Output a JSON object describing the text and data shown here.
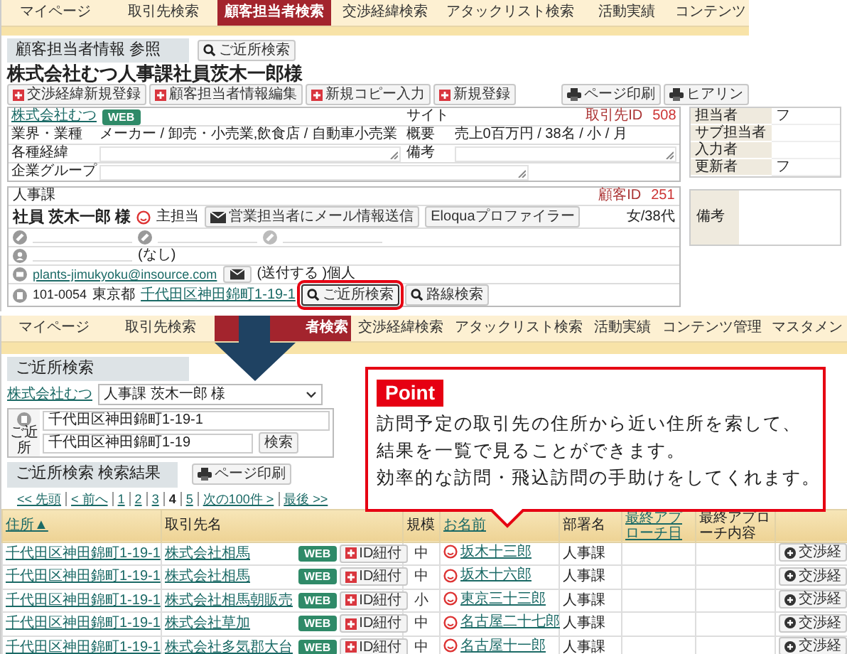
{
  "top_screen": {
    "nav_tabs": [
      {
        "label": "マイページ",
        "selected": false
      },
      {
        "label": "取引先検索",
        "selected": false
      },
      {
        "label": "顧客担当者検索",
        "selected": true
      },
      {
        "label": "交渉経緯検索",
        "selected": false
      },
      {
        "label": "アタックリスト検索",
        "selected": false
      },
      {
        "label": "活動実績",
        "selected": false
      },
      {
        "label": "コンテンツ",
        "selected": false
      }
    ],
    "section_title": "顧客担当者情報 参照",
    "nearby_button": "ご近所検索",
    "page_title": "株式会社むつ人事課社員茨木一郎様",
    "action_buttons": [
      "交渉経緯新規登録",
      "顧客担当者情報編集",
      "新規コピー入力",
      "新規登録"
    ],
    "print_buttons": [
      "ページ印刷",
      "ヒアリン"
    ],
    "company": {
      "name": "株式会社むつ",
      "web_badge": "WEB",
      "site_label": "サイト",
      "id_label": "取引先ID",
      "id": "508",
      "fields": [
        {
          "label": "業界・業種",
          "value": "メーカー / 卸売・小売業,飲食店 / 自動車小売業",
          "label2": "概要",
          "value2": "売上0百万円 / 38名 / 小 / 月"
        },
        {
          "label": "各種経緯",
          "label2": "備考"
        },
        {
          "label": "企業グループ"
        }
      ]
    },
    "contact": {
      "department": "人事課",
      "id_label": "顧客ID",
      "id": "251",
      "gender_age": "女/38代",
      "name": "社員 茨木一郎 様",
      "role": "主担当",
      "mail_button": "営業担当者にメール情報送信",
      "profiler_button": "Eloquaプロファイラー",
      "no_value": "(なし)",
      "email": "plants-jimukyoku@insource.com",
      "send_status": "(送付する )個人",
      "postal_code": "101-0054",
      "prefecture": "東京都",
      "address": "千代田区神田錦町1-19-1",
      "nearby_button": {
        "label": "ご近所検索",
        "highlighted": true
      },
      "route_button": "路線検索"
    },
    "staff_table": [
      {
        "label": "担当者",
        "value": "フ"
      },
      {
        "label": "サブ担当者"
      },
      {
        "label": "入力者"
      },
      {
        "label": "更新者",
        "value": "フ"
      }
    ],
    "notes_label": "備考"
  },
  "bottom_screen": {
    "nav_tabs": [
      {
        "label": "マイページ",
        "selected": false
      },
      {
        "label": "取引先検索",
        "selected": false
      },
      {
        "label": "者検索",
        "selected": true
      },
      {
        "label": "交渉経緯検索",
        "selected": false
      },
      {
        "label": "アタックリスト検索",
        "selected": false
      },
      {
        "label": "活動実績",
        "selected": false
      },
      {
        "label": "コンテンツ管理",
        "selected": false
      },
      {
        "label": "マスタメン",
        "selected": false
      }
    ],
    "section_title": "ご近所検索",
    "company_link": "株式会社むつ",
    "contact_select": "人事課 茨木一郎 様",
    "base_address": "千代田区神田錦町1-19-1",
    "nearby_label": "ご近所",
    "search_input": "千代田区神田錦町1-19",
    "search_button": "検索",
    "results_title": "ご近所検索 検索結果",
    "print_button": "ページ印刷",
    "pager": [
      {
        "label": "<< 先頭",
        "selected": false
      },
      {
        "label": "< 前へ",
        "selected": false
      },
      {
        "label": "1",
        "selected": false
      },
      {
        "label": "2",
        "selected": false
      },
      {
        "label": "3",
        "selected": false
      },
      {
        "label": "4",
        "selected": true
      },
      {
        "label": "5",
        "selected": false
      },
      {
        "label": "次の100件 >",
        "selected": false
      },
      {
        "label": "最後 >>",
        "selected": false
      }
    ],
    "columns": [
      "住所▲",
      "取引先名",
      "規模",
      "お名前",
      "部署名",
      "最終アプローチ日",
      "最終アプローチ内容"
    ],
    "rows": [
      {
        "address": "千代田区神田錦町1-19-1",
        "company": "株式会社相馬",
        "web": "WEB",
        "id_button": "ID紐付",
        "size": "中",
        "name": "坂木十三郎",
        "department": "人事課",
        "action": "交渉経"
      },
      {
        "address": "千代田区神田錦町1-19-1",
        "company": "株式会社相馬",
        "web": "WEB",
        "id_button": "ID紐付",
        "size": "中",
        "name": "坂木十六郎",
        "department": "人事課",
        "action": "交渉経"
      },
      {
        "address": "千代田区神田錦町1-19-1",
        "company": "株式会社相馬朝販売",
        "web": "WEB",
        "id_button": "ID紐付",
        "size": "小",
        "name": "東京三十三郎",
        "department": "人事課",
        "action": "交渉経"
      },
      {
        "address": "千代田区神田錦町1-19-1",
        "company": "株式会社草加",
        "web": "WEB",
        "id_button": "ID紐付",
        "size": "中",
        "name": "名古屋二十七郎",
        "department": "人事課",
        "action": "交渉経"
      },
      {
        "address": "千代田区神田錦町1-19-1",
        "company": "株式会社多気郡大台",
        "web": "WEB",
        "id_button": "ID紐付",
        "size": "中",
        "name": "名古屋十一郎",
        "department": "人事課",
        "action": "交渉経"
      }
    ]
  },
  "point": {
    "badge": "Point",
    "lines": [
      "訪問予定の取引先の住所から近い住所を索して、",
      "結果を一覧で見ることができます。",
      "効率的な訪問・飛込訪問の手助けをしてくれます。"
    ]
  }
}
